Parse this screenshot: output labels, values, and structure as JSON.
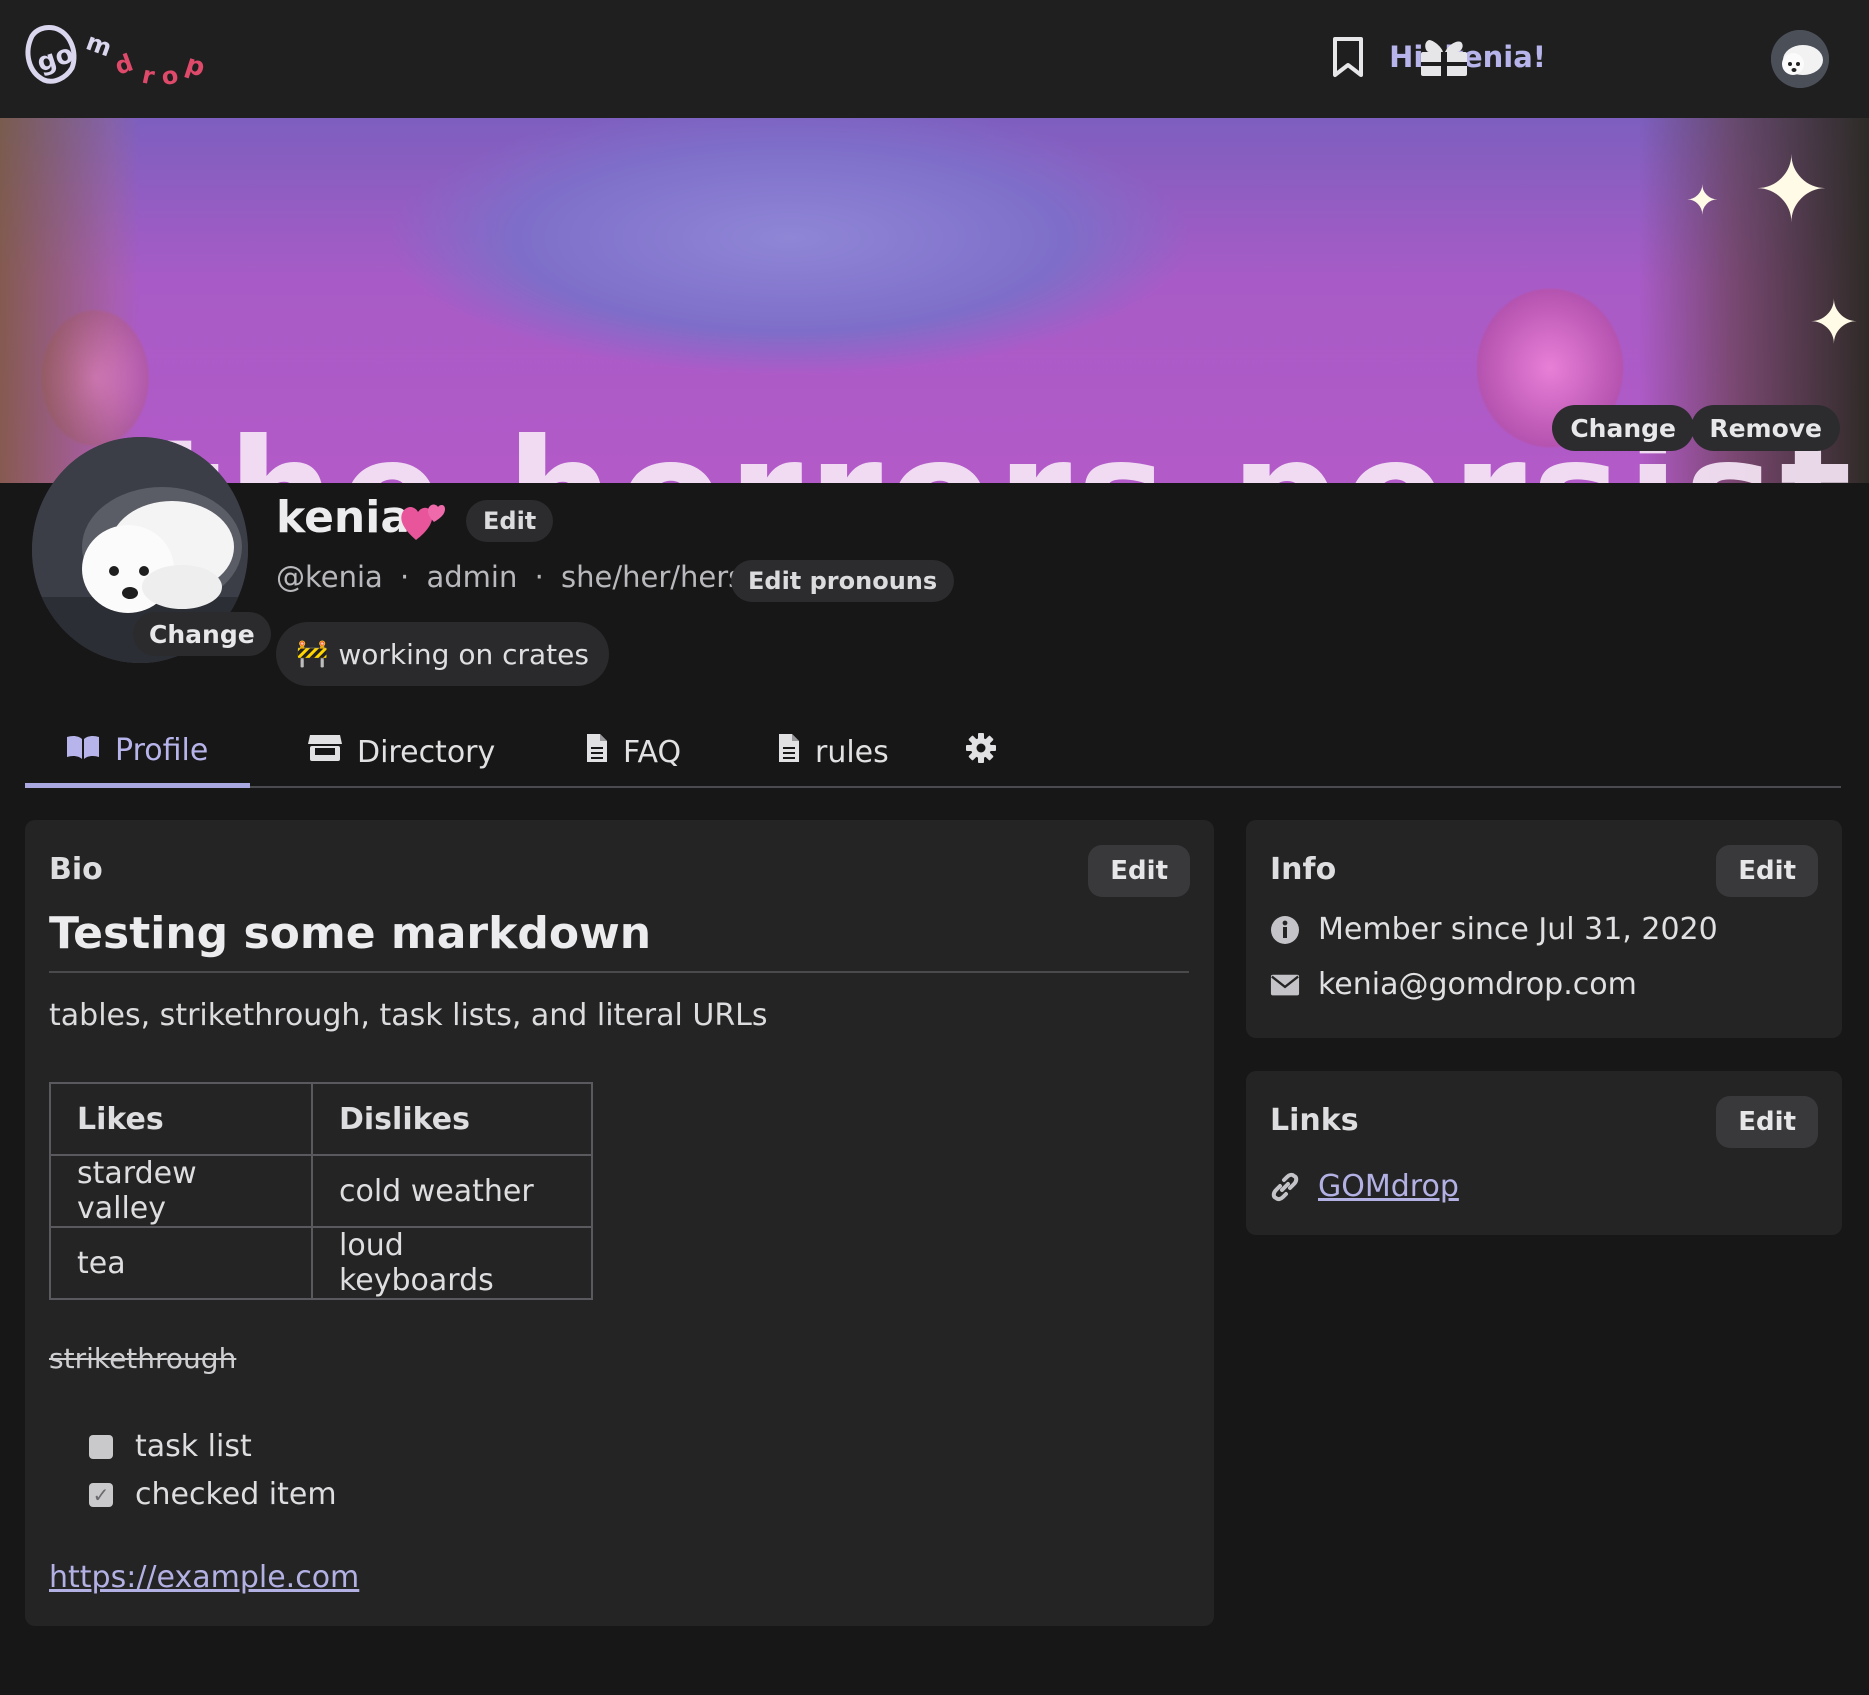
{
  "nav": {
    "logo_text": "gomdrop",
    "greeting": "Hi, kenia!",
    "accent_color": "#b6b4ea",
    "icons": [
      "bookmark-icon",
      "gift-icon",
      "user-avatar"
    ]
  },
  "banner": {
    "overlay_text": "the horrors persist",
    "change_label": "Change",
    "remove_label": "Remove"
  },
  "profile": {
    "avatar_change_label": "Change",
    "name": "kenia",
    "name_emoji": "💕",
    "edit_label": "Edit",
    "handle": "@kenia",
    "separator": "·",
    "role": "admin",
    "pronouns": "she/her/hers",
    "edit_pronouns_label": "Edit pronouns",
    "status_emoji": "🚧",
    "status_text": "working on crates"
  },
  "tabs": [
    {
      "label": "Profile",
      "icon": "book-open-icon",
      "active": true
    },
    {
      "label": "Directory",
      "icon": "store-icon",
      "active": false
    },
    {
      "label": "FAQ",
      "icon": "document-icon",
      "active": false
    },
    {
      "label": "rules",
      "icon": "document-icon",
      "active": false
    },
    {
      "label": "",
      "icon": "gear-icon",
      "active": false
    }
  ],
  "bio": {
    "title": "Bio",
    "edit_label": "Edit",
    "heading": "Testing some markdown",
    "paragraph": "tables, strikethrough, task lists, and literal URLs",
    "table": {
      "headers": [
        "Likes",
        "Dislikes"
      ],
      "rows": [
        [
          "stardew valley",
          "cold weather"
        ],
        [
          "tea",
          "loud keyboards"
        ]
      ]
    },
    "strikethrough": "strikethrough",
    "tasks": [
      {
        "label": "task list",
        "checked": false
      },
      {
        "label": "checked item",
        "checked": true
      }
    ],
    "url": "https://example.com"
  },
  "info": {
    "title": "Info",
    "edit_label": "Edit",
    "member_since": "Member since Jul 31, 2020",
    "email": "kenia@gomdrop.com"
  },
  "links": {
    "title": "Links",
    "edit_label": "Edit",
    "items": [
      "GOMdrop"
    ]
  }
}
